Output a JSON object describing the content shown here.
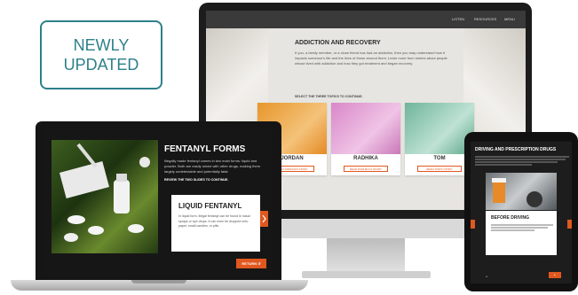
{
  "badge": {
    "line1": "NEWLY",
    "line2": "UPDATED"
  },
  "desktop": {
    "nav": {
      "listen": "LISTEN",
      "resources": "RESOURCES",
      "menu": "MENU"
    },
    "title": "ADDICTION AND RECOVERY",
    "body": "If you, a family member, or a close friend has had an addiction, then you may understand how it impacts someone's life and the lives of those around them. Learn more from stories about people whose lived with addiction and how they got treatment and began recovery.",
    "instruction": "SELECT THE THREE TOPICS TO CONTINUE.",
    "cards": [
      {
        "name": "JORDAN",
        "button": "READ JORDAN'S STORY",
        "color": "#e7962a"
      },
      {
        "name": "RADHIKA",
        "button": "READ RADHIKA'S STORY",
        "color": "#d987c8"
      },
      {
        "name": "TOM",
        "button": "READ TOM'S STORY",
        "color": "#6fb59b"
      }
    ]
  },
  "laptop": {
    "title": "FENTANYL FORMS",
    "body": "Illegally made fentanyl comes in two main forms: liquid and powder. Both are easily mixed with other drugs, making them largely undetectable and potentially fatal.",
    "instruction": "REVIEW THE TWO SLIDES TO CONTINUE.",
    "panel_title": "LIQUID FENTANYL",
    "panel_body": "In liquid form, illegal fentanyl can be found in nasal sprays or eye drops. It can even be dropped onto paper, small candies, or pills.",
    "return_label": "RETURN"
  },
  "tablet": {
    "title": "DRIVING AND PRESCRIPTION DRUGS",
    "panel_title": "BEFORE DRIVING"
  },
  "colors": {
    "accent": "#e0581f",
    "teal": "#2d8089"
  }
}
